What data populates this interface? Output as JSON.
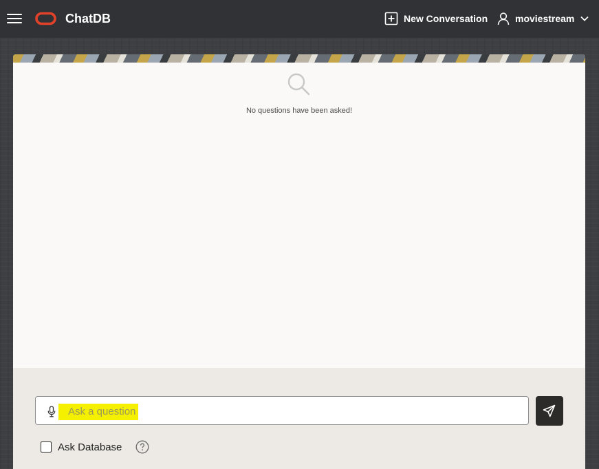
{
  "header": {
    "menu_icon": "hamburger-icon",
    "logo_icon": "oracle-logo-icon",
    "app_title": "ChatDB",
    "new_conversation_label": "New Conversation",
    "new_conversation_icon": "plus-square-icon",
    "user_icon": "user-icon",
    "username": "moviestream",
    "user_menu_icon": "chevron-down-icon"
  },
  "main": {
    "empty_state_icon": "search-icon",
    "empty_message": "No questions have been asked!"
  },
  "footer": {
    "mic_icon": "microphone-icon",
    "input_value": "",
    "input_placeholder": "Ask a question",
    "send_icon": "send-icon",
    "ask_database_label": "Ask Database",
    "ask_database_checked": false,
    "help_icon": "help-icon"
  },
  "colors": {
    "header_bg": "#303235",
    "brand_red": "#e2412a",
    "panel_bg": "#faf9f7",
    "footer_bg": "#ede9e4",
    "send_button_bg": "#2c2b29",
    "highlight": "#f5f000"
  }
}
